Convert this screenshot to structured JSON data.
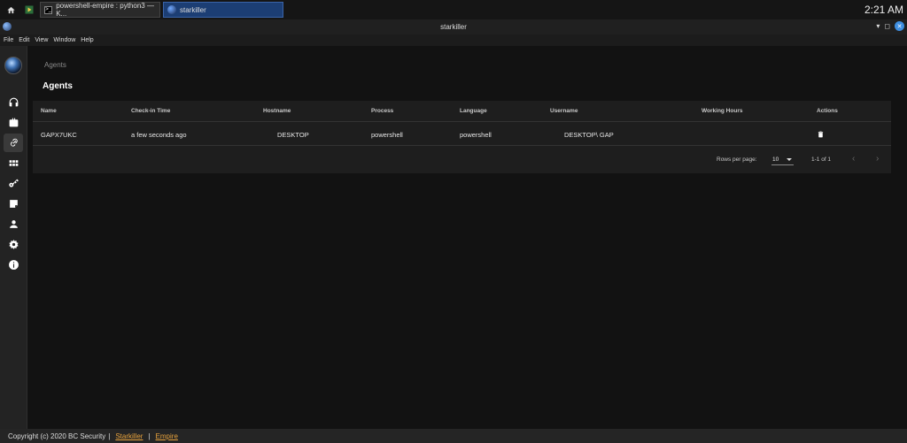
{
  "taskbar": {
    "tasks": [
      {
        "label": "powershell-empire : python3 — K..."
      },
      {
        "label": "starkiller"
      }
    ],
    "clock": "2:21 AM"
  },
  "window": {
    "title": "starkiller",
    "menu": [
      "File",
      "Edit",
      "View",
      "Window",
      "Help"
    ]
  },
  "sidebar": {
    "items": [
      {
        "name": "listeners",
        "icon": "headphones-icon",
        "active": false
      },
      {
        "name": "stagers",
        "icon": "briefcase-icon",
        "active": false
      },
      {
        "name": "agents",
        "icon": "link-icon",
        "active": true
      },
      {
        "name": "modules",
        "icon": "apps-icon",
        "active": false
      },
      {
        "name": "credentials",
        "icon": "key-icon",
        "active": false
      },
      {
        "name": "reporting",
        "icon": "note-icon",
        "active": false
      },
      {
        "name": "users",
        "icon": "user-icon",
        "active": false
      },
      {
        "name": "settings",
        "icon": "gear-icon",
        "active": false
      },
      {
        "name": "about",
        "icon": "info-icon",
        "active": false
      }
    ]
  },
  "page": {
    "breadcrumb": "Agents",
    "title": "Agents"
  },
  "table": {
    "columns": [
      "Name",
      "Check-in Time",
      "Hostname",
      "Process",
      "Language",
      "Username",
      "Working Hours",
      "Actions"
    ],
    "rows": [
      {
        "name": "GAPX7UKC",
        "checkin": "a few seconds ago",
        "hostname": "DESKTOP",
        "process": "powershell",
        "language": "powershell",
        "username": "DESKTOP\\ GAP",
        "working_hours": ""
      }
    ],
    "pagination": {
      "rows_per_page_label": "Rows per page:",
      "rows_per_page": "10",
      "range": "1-1 of 1"
    }
  },
  "footer": {
    "copyright": "Copyright (c) 2020 BC Security",
    "sep": "|",
    "link1": "Starkiller",
    "link2": "Empire"
  },
  "colors": {
    "accent": "#e8a33d",
    "active_task": "#1c3e74"
  }
}
